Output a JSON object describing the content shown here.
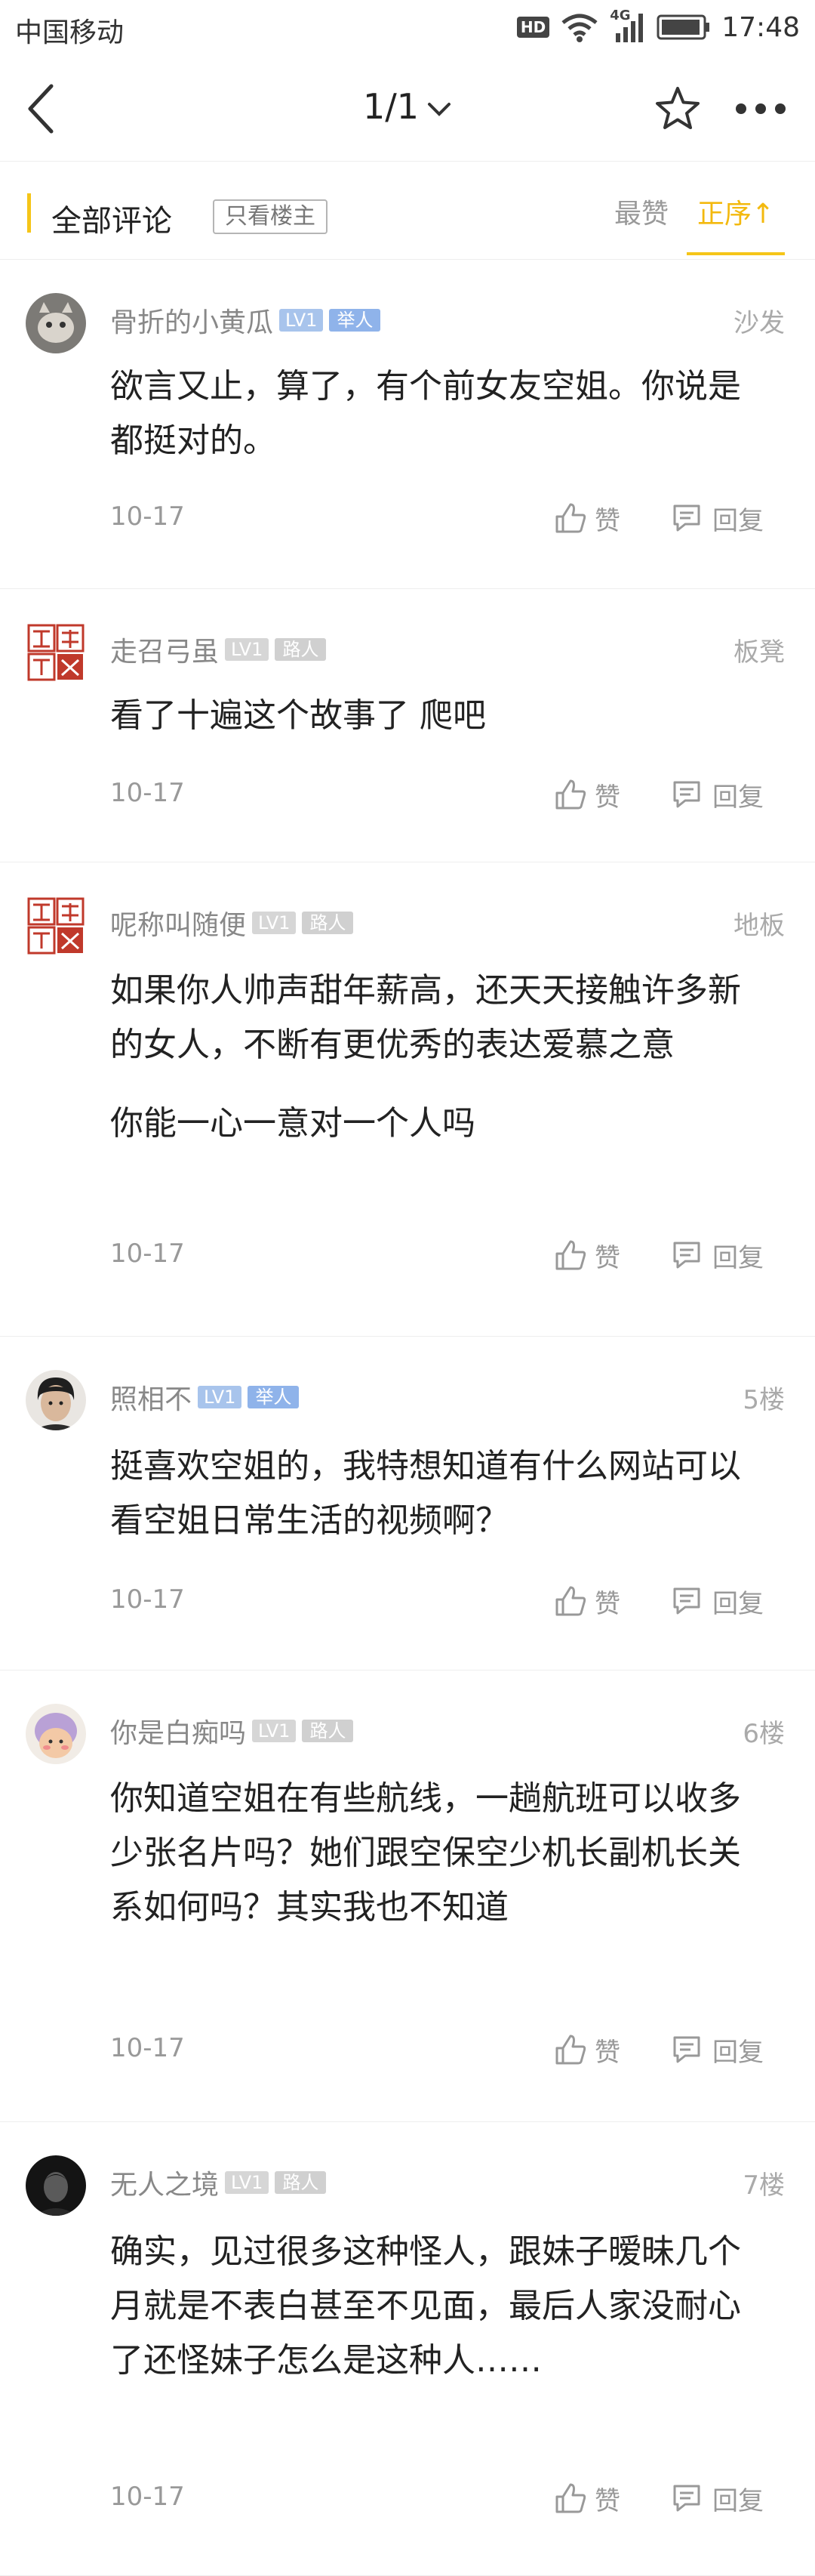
{
  "status_bar": {
    "carrier": "中国移动",
    "hd": "HD",
    "network": "4G",
    "time": "17:48"
  },
  "nav": {
    "page_indicator": "1/1"
  },
  "filter": {
    "all_comments": "全部评论",
    "owner_only": "只看楼主",
    "sort_hot": "最赞",
    "sort_order": "正序↑"
  },
  "comments": [
    {
      "username": "骨折的小黄瓜",
      "level": "LV1",
      "role": "举人",
      "floor": "沙发",
      "paragraphs": [
        "欲言又止，算了，有个前女友空姐。你说是都挺对的。"
      ],
      "date": "10-17",
      "like_label": "赞",
      "reply_label": "回复"
    },
    {
      "username": "走召弓虽",
      "level": "LV1",
      "role": "路人",
      "floor": "板凳",
      "paragraphs": [
        "看了十遍这个故事了 爬吧"
      ],
      "date": "10-17",
      "like_label": "赞",
      "reply_label": "回复"
    },
    {
      "username": "呢称叫随便",
      "level": "LV1",
      "role": "路人",
      "floor": "地板",
      "paragraphs": [
        "如果你人帅声甜年薪高，还天天接触许多新的女人，不断有更优秀的表达爱慕之意",
        "你能一心一意对一个人吗"
      ],
      "date": "10-17",
      "like_label": "赞",
      "reply_label": "回复"
    },
    {
      "username": "照相不",
      "level": "LV1",
      "role": "举人",
      "floor": "5楼",
      "paragraphs": [
        "挺喜欢空姐的，我特想知道有什么网站可以看空姐日常生活的视频啊？"
      ],
      "date": "10-17",
      "like_label": "赞",
      "reply_label": "回复"
    },
    {
      "username": "你是白痴吗",
      "level": "LV1",
      "role": "路人",
      "floor": "6楼",
      "paragraphs": [
        "你知道空姐在有些航线，一趟航班可以收多少张名片吗？她们跟空保空少机长副机长关系如何吗？其实我也不知道"
      ],
      "date": "10-17",
      "like_label": "赞",
      "reply_label": "回复"
    },
    {
      "username": "无人之境",
      "level": "LV1",
      "role": "路人",
      "floor": "7楼",
      "paragraphs": [
        "确实，见过很多这种怪人，跟妹子暧昧几个月就是不表白甚至不见面，最后人家没耐心了还怪妹子怎么是这种人……"
      ],
      "date": "10-17",
      "like_label": "赞",
      "reply_label": "回复"
    }
  ],
  "colors": {
    "accent": "#f5c518",
    "sort_active": "#f3b90e",
    "blue_badge": "#8fb3ea",
    "gray_badge": "#d0d0d0"
  }
}
